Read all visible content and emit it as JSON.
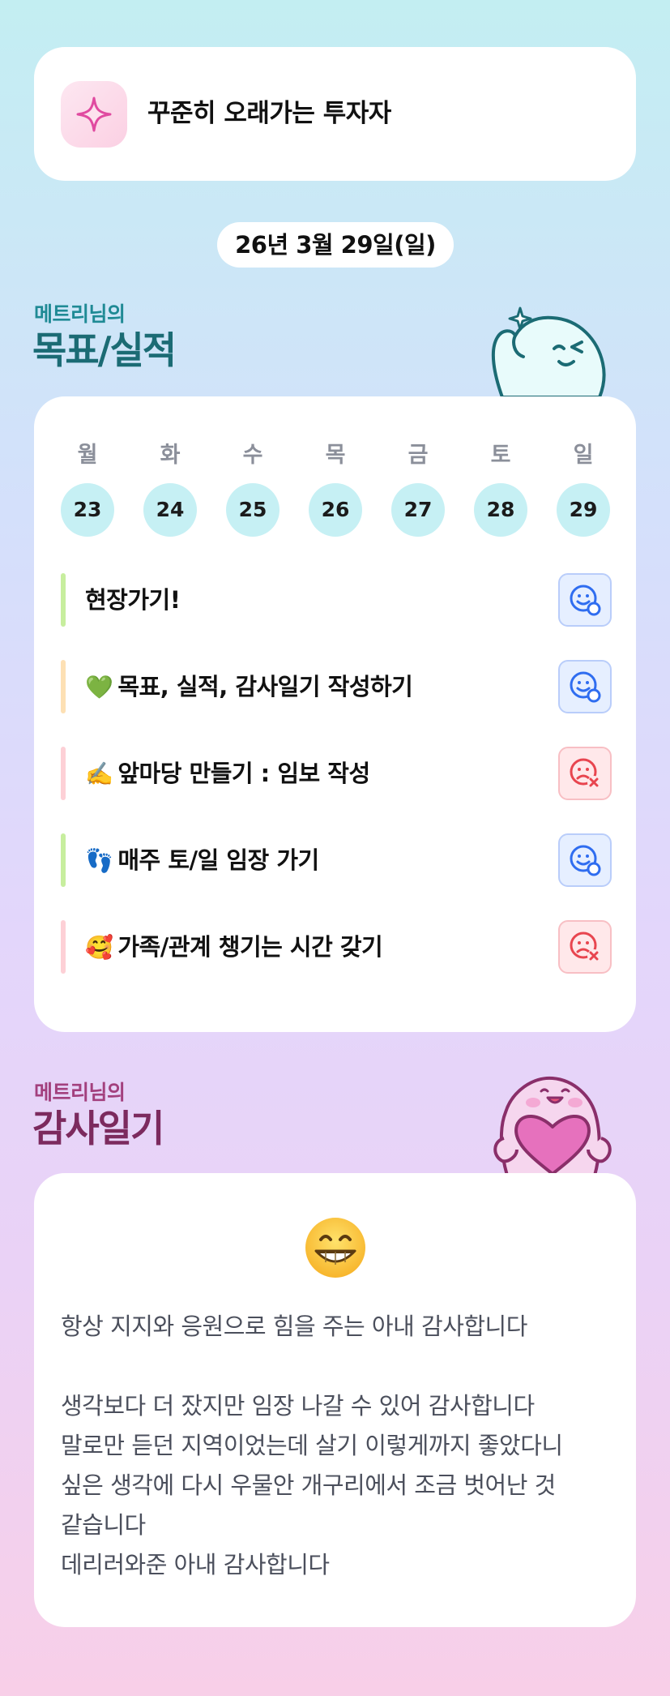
{
  "profile": {
    "title": "꾸준히 오래가는 투자자",
    "badge_icon": "sparkle-icon"
  },
  "date_label": "26년 3월 29일(일)",
  "goals_section": {
    "subtitle": "메트리님의",
    "title": "목표/실적"
  },
  "week": {
    "days": [
      {
        "weekday": "월",
        "date": "23"
      },
      {
        "weekday": "화",
        "date": "24"
      },
      {
        "weekday": "수",
        "date": "25"
      },
      {
        "weekday": "목",
        "date": "26"
      },
      {
        "weekday": "금",
        "date": "27"
      },
      {
        "weekday": "토",
        "date": "28"
      },
      {
        "weekday": "일",
        "date": "29"
      }
    ]
  },
  "goals": [
    {
      "emoji": "",
      "text": "현장가기!",
      "status": "done",
      "bar_color": "#c7ee9e"
    },
    {
      "emoji": "💚",
      "text": "목표, 실적, 감사일기 작성하기",
      "status": "done",
      "bar_color": "#fde0b4"
    },
    {
      "emoji": "✍️",
      "text": "앞마당 만들기 : 임보 작성",
      "status": "fail",
      "bar_color": "#fdd0d6"
    },
    {
      "emoji": "👣",
      "text": "매주 토/일 임장 가기",
      "status": "done",
      "bar_color": "#c7ee9e"
    },
    {
      "emoji": "🥰",
      "text": "가족/관계 챙기는 시간 갖기",
      "status": "fail",
      "bar_color": "#fdd0d6"
    }
  ],
  "diary_section": {
    "subtitle": "메트리님의",
    "title": "감사일기"
  },
  "diary": {
    "mood_emoji": "😁",
    "text": "항상 지지와 응원으로 힘을 주는 아내 감사합니다\n\n생각보다 더 잤지만 임장 나갈 수 있어 감사합니다\n말로만 듣던 지역이었는데 살기 이렇게까지 좋았다니\n싶은 생각에 다시 우물안 개구리에서 조금 벗어난 것\n같습니다\n데리러와준 아내 감사합니다"
  },
  "colors": {
    "done_icon": "#2f6df0",
    "fail_icon": "#e8454f",
    "day_circle": "#c6f0f4",
    "goals_title": "#1b6b74",
    "diary_title": "#7c2a5e"
  }
}
